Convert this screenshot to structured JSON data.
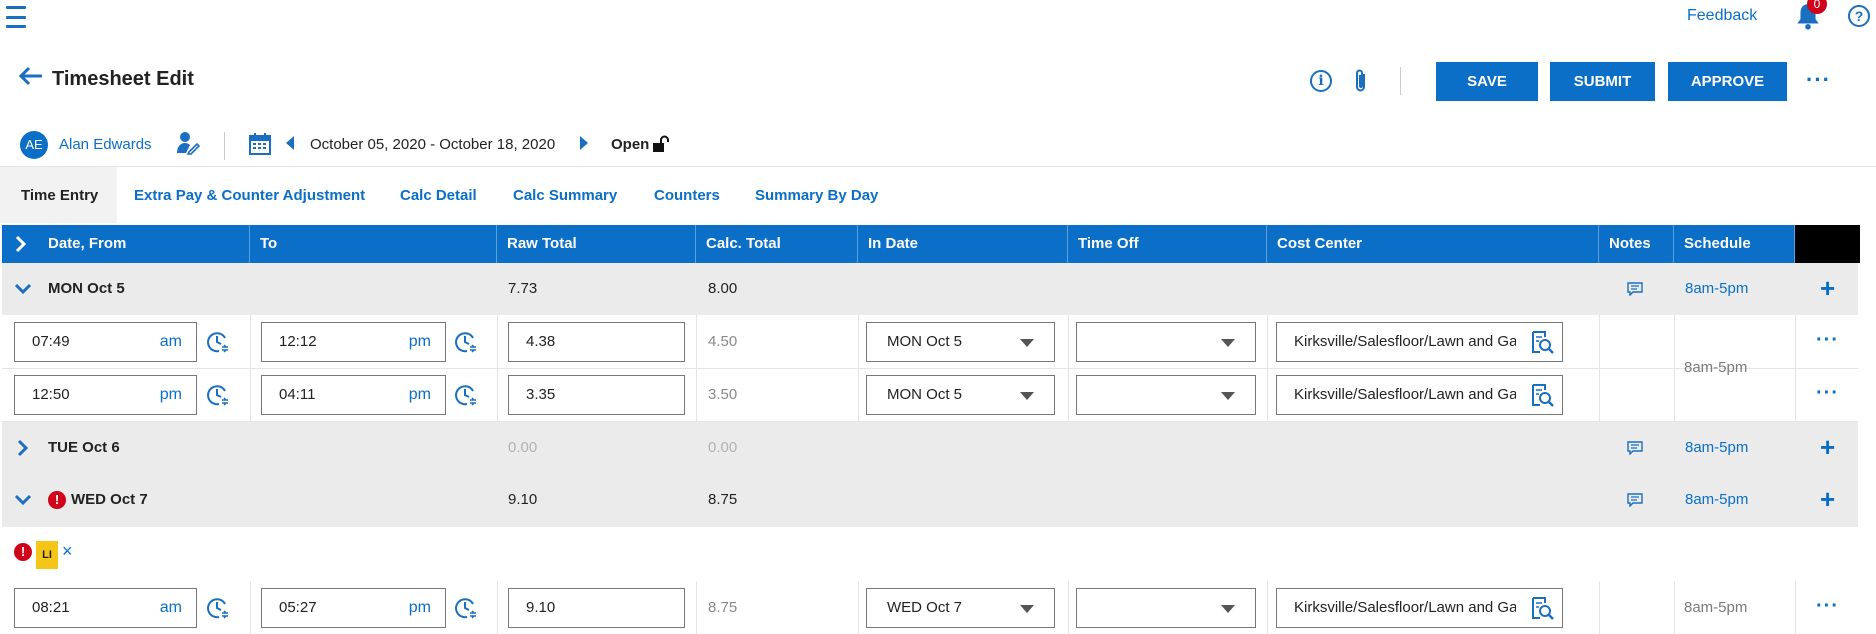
{
  "topbar": {
    "feedback": "Feedback",
    "notification_count": "0",
    "help": "?"
  },
  "header": {
    "title": "Timesheet Edit",
    "buttons": {
      "save": "SAVE",
      "submit": "SUBMIT",
      "approve": "APPROVE"
    },
    "more": "···"
  },
  "user": {
    "initials": "AE",
    "name": "Alan Edwards",
    "date_range": "October 05, 2020 - October 18, 2020",
    "status": "Open"
  },
  "tabs": [
    "Time Entry",
    "Extra Pay & Counter Adjustment",
    "Calc Detail",
    "Calc Summary",
    "Counters",
    "Summary By Day"
  ],
  "columns": [
    "Date, From",
    "To",
    "Raw Total",
    "Calc. Total",
    "In Date",
    "Time Off",
    "Cost Center",
    "Notes",
    "Schedule"
  ],
  "days": [
    {
      "label": "MON Oct 5",
      "raw": "7.73",
      "calc": "8.00",
      "schedule": "8am-5pm",
      "entries": [
        {
          "from": "07:49",
          "from_ap": "am",
          "to": "12:12",
          "to_ap": "pm",
          "raw": "4.38",
          "calc": "4.50",
          "in_date": "MON Oct 5",
          "cost_center": "Kirksville/Salesfloor/Lawn and Garden"
        },
        {
          "from": "12:50",
          "from_ap": "pm",
          "to": "04:11",
          "to_ap": "pm",
          "raw": "3.35",
          "calc": "3.50",
          "in_date": "MON Oct 5",
          "cost_center": "Kirksville/Salesfloor/Lawn and Garden"
        }
      ],
      "entry_schedule": "8am-5pm"
    },
    {
      "label": "TUE Oct 6",
      "raw": "0.00",
      "calc": "0.00",
      "schedule": "8am-5pm"
    },
    {
      "label": "WED Oct 7",
      "raw": "9.10",
      "calc": "8.75",
      "schedule": "8am-5pm",
      "warning_badge": "LI",
      "remove": "×",
      "entries": [
        {
          "from": "08:21",
          "from_ap": "am",
          "to": "05:27",
          "to_ap": "pm",
          "raw": "9.10",
          "calc": "8.75",
          "in_date": "WED Oct 7",
          "cost_center": "Kirksville/Salesfloor/Lawn and Garden"
        }
      ],
      "entry_schedule": "8am-5pm"
    }
  ],
  "colors": {
    "accent": "#0c6fc7",
    "row_bg": "#ebebeb",
    "error": "#d0021b",
    "badge": "#f5c518"
  }
}
